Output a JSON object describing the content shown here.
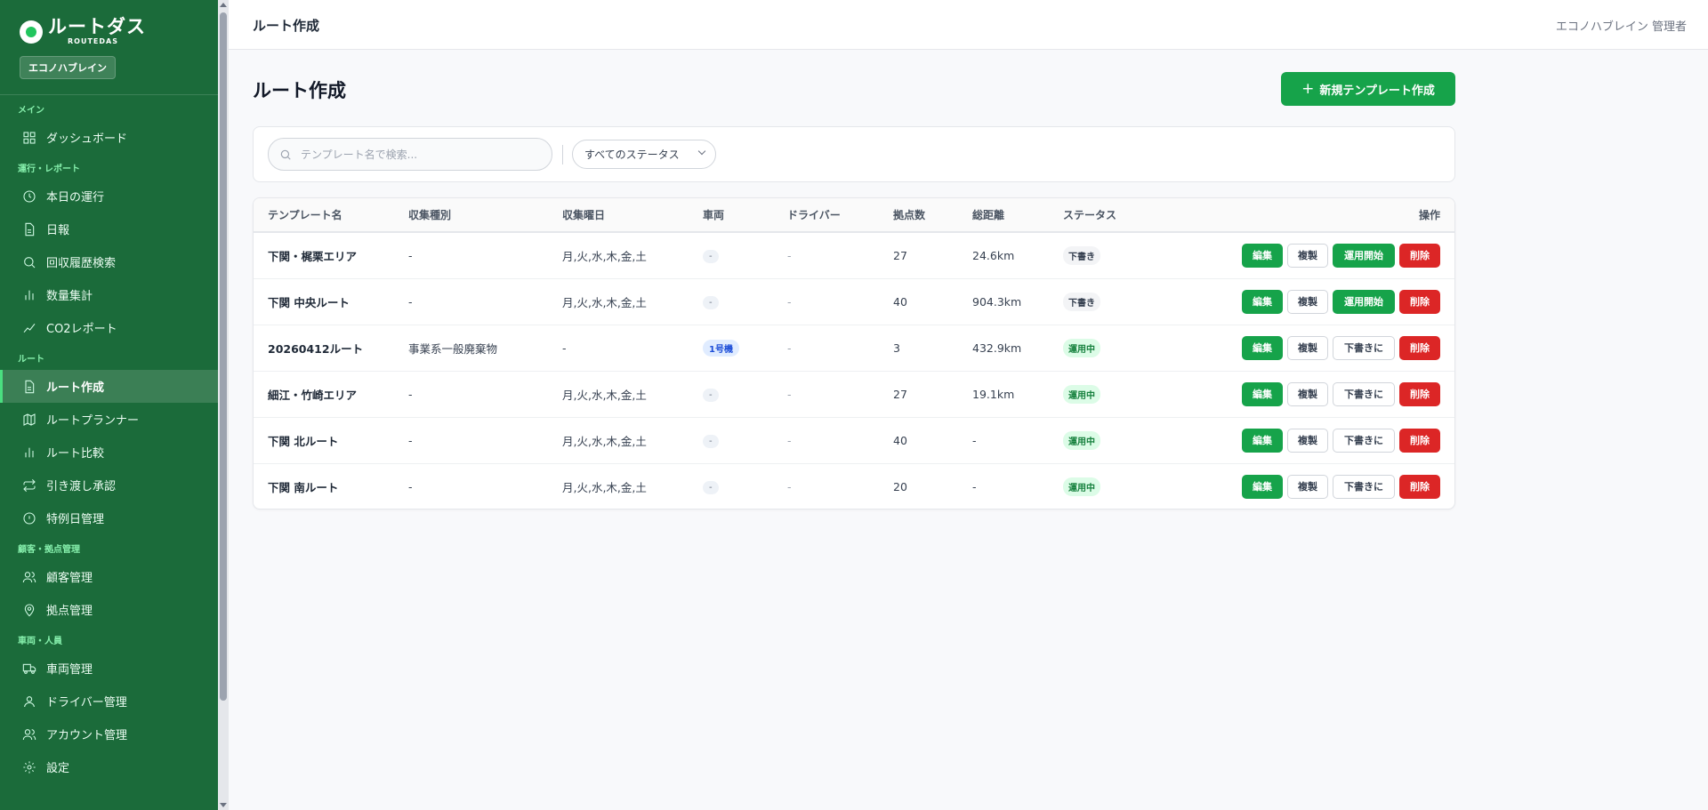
{
  "brand": {
    "name": "ルートダス",
    "sub": "ROUTEDAS",
    "company": "エコノハブレイン"
  },
  "sidebar": {
    "sections": [
      {
        "label": "メイン",
        "items": [
          {
            "label": "ダッシュボード",
            "icon": "grid-icon"
          }
        ]
      },
      {
        "label": "運行・レポート",
        "items": [
          {
            "label": "本日の運行",
            "icon": "clock-icon"
          },
          {
            "label": "日報",
            "icon": "document-icon"
          },
          {
            "label": "回収履歴検索",
            "icon": "search-icon"
          },
          {
            "label": "数量集計",
            "icon": "bar-chart-icon"
          },
          {
            "label": "CO2レポート",
            "icon": "trend-icon"
          }
        ]
      },
      {
        "label": "ルート",
        "items": [
          {
            "label": "ルート作成",
            "icon": "document-icon",
            "active": true
          },
          {
            "label": "ルートプランナー",
            "icon": "map-icon"
          },
          {
            "label": "ルート比較",
            "icon": "bar-chart-icon"
          },
          {
            "label": "引き渡し承認",
            "icon": "repeat-icon"
          },
          {
            "label": "特例日管理",
            "icon": "info-circle-icon"
          }
        ]
      },
      {
        "label": "顧客・拠点管理",
        "items": [
          {
            "label": "顧客管理",
            "icon": "users-icon"
          },
          {
            "label": "拠点管理",
            "icon": "map-pin-icon"
          }
        ]
      },
      {
        "label": "車両・人員",
        "items": [
          {
            "label": "車両管理",
            "icon": "truck-icon"
          },
          {
            "label": "ドライバー管理",
            "icon": "user-icon"
          },
          {
            "label": "アカウント管理",
            "icon": "users-icon"
          },
          {
            "label": "設定",
            "icon": "gear-icon"
          }
        ]
      }
    ]
  },
  "header": {
    "title": "ルート作成",
    "user": "エコノハブレイン 管理者"
  },
  "main": {
    "title": "ルート作成",
    "new_button": "新規テンプレート作成",
    "search_placeholder": "テンプレート名で検索...",
    "status_filter": "すべてのステータス"
  },
  "table": {
    "columns": [
      "テンプレート名",
      "収集種別",
      "収集曜日",
      "車両",
      "ドライバー",
      "拠点数",
      "総距離",
      "ステータス",
      "操作"
    ],
    "rows": [
      {
        "name": "下関・梶栗エリア",
        "type": "-",
        "days": "月,火,水,木,金,土",
        "vehicle": "-",
        "driver": "-",
        "points": "27",
        "distance": "24.6km",
        "status": "下書き",
        "status_kind": "draft",
        "toggle": "運用開始"
      },
      {
        "name": "下関 中央ルート",
        "type": "-",
        "days": "月,火,水,木,金,土",
        "vehicle": "-",
        "driver": "-",
        "points": "40",
        "distance": "904.3km",
        "status": "下書き",
        "status_kind": "draft",
        "toggle": "運用開始"
      },
      {
        "name": "20260412ルート",
        "type": "事業系一般廃棄物",
        "days": "-",
        "vehicle": "1号機",
        "driver": "-",
        "points": "3",
        "distance": "432.9km",
        "status": "運用中",
        "status_kind": "active",
        "toggle": "下書きに"
      },
      {
        "name": "細江・竹崎エリア",
        "type": "-",
        "days": "月,火,水,木,金,土",
        "vehicle": "-",
        "driver": "-",
        "points": "27",
        "distance": "19.1km",
        "status": "運用中",
        "status_kind": "active",
        "toggle": "下書きに"
      },
      {
        "name": "下関 北ルート",
        "type": "-",
        "days": "月,火,水,木,金,土",
        "vehicle": "-",
        "driver": "-",
        "points": "40",
        "distance": "-",
        "status": "運用中",
        "status_kind": "active",
        "toggle": "下書きに"
      },
      {
        "name": "下関 南ルート",
        "type": "-",
        "days": "月,火,水,木,金,土",
        "vehicle": "-",
        "driver": "-",
        "points": "20",
        "distance": "-",
        "status": "運用中",
        "status_kind": "active",
        "toggle": "下書きに"
      }
    ],
    "action_labels": {
      "edit": "編集",
      "copy": "複製",
      "delete": "削除"
    }
  },
  "colors": {
    "sidebar_bg": "#1b6b3a",
    "accent": "#16a34a",
    "danger": "#dc2626"
  }
}
